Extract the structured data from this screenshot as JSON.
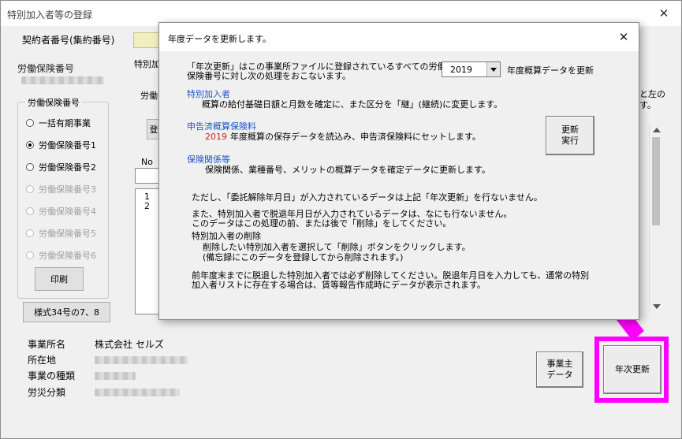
{
  "window": {
    "title": "特別加入者等の登録",
    "close": "✕"
  },
  "main": {
    "contract_label": "契約者番号(集約番号)",
    "roudou_label": "労働保険番号",
    "group_title": "労働保険番号",
    "radios": [
      {
        "label": "一括有期事業",
        "checked": false,
        "disabled": false
      },
      {
        "label": "労働保険番号1",
        "checked": true,
        "disabled": false
      },
      {
        "label": "労働保険番号2",
        "checked": false,
        "disabled": false
      },
      {
        "label": "労働保険番号3",
        "checked": false,
        "disabled": true
      },
      {
        "label": "労働保険番号4",
        "checked": false,
        "disabled": true
      },
      {
        "label": "労働保険番号5",
        "checked": false,
        "disabled": true
      },
      {
        "label": "労働保険番号6",
        "checked": false,
        "disabled": true
      }
    ],
    "print_button": "印刷",
    "form_button": "様式34号の7、8",
    "tab_partial": "特別加",
    "label_partial": "労働",
    "btn_partial": "登",
    "no_header": "No",
    "list_rows": [
      "1",
      "2"
    ],
    "right_partial_text": "と左の\n す。",
    "jigyousho_label": "事業所名",
    "jigyousho_value": "株式会社 セルズ",
    "shozaichi_label": "所在地",
    "shurui_label": "事業の種類",
    "rousai_label": "労災分類",
    "jigyounushi_button_l1": "事業主",
    "jigyounushi_button_l2": "データ",
    "nenji_button": "年次更新"
  },
  "dialog": {
    "title": "年度データを更新します。",
    "close": "✕",
    "intro_l1": "「年次更新」はこの事業所ファイルに登録されているすべての労働",
    "intro_l2": "保険番号に対し次の処理をおこないます。",
    "year_value": "2019",
    "year_suffix": "年度概算データを更新",
    "s1_heading": "特別加入者",
    "s1_text": "概算の給付基礎日額と月数を確定に、また区分を「継」(継続)に変更します。",
    "s2_heading": "申告済概算保険料",
    "s2_year": "2019",
    "s2_text": "年度概算の保存データを読込み、申告済保険料にセットします。",
    "s3_heading": "保険関係等",
    "s3_text": "保険関係、業種番号、メリットの概算データを確定データに更新します。",
    "update_button_l1": "更新",
    "update_button_l2": "実行",
    "note1": "ただし、「委託解除年月日」が入力されているデータは上記「年次更新」を行ないません。",
    "note2_l1": "また、特別加入者で脱退年月日が入力されているデータは、なにも行ないません。",
    "note2_l2": "このデータはこの処理の前、または後で「削除」をしてください。",
    "note3_l1": "特別加入者の削除",
    "note3_l2": "削除したい特別加入者を選択して「削除」ボタンをクリックします。",
    "note3_l3": "(備忘録にこのデータを登録してから削除されます。)",
    "note4_l1": "前年度末までに脱退した特別加入者では必ず削除してください。脱退年月日を入力しても、通常の特別",
    "note4_l2": "加入者リストに存在する場合は、賃等報告作成時にデータが表示されます。"
  },
  "colors": {
    "highlight": "#ff00ff",
    "heading_blue": "#1c55c8",
    "year_red": "#d02020"
  },
  "icons": {
    "arrow": "magenta-arrow-icon",
    "dropdown": "dropdown-arrow-icon",
    "scroll_up": "scroll-up-icon",
    "scroll_down": "scroll-down-icon"
  }
}
